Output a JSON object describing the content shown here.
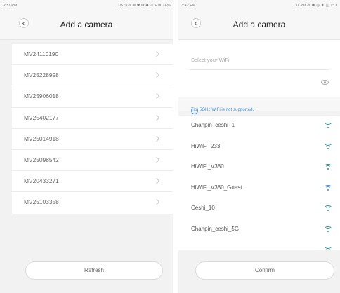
{
  "left_screen": {
    "status": {
      "time": "3:37 PM",
      "icons": "...057K/s ⦾ ✱ ◎ ✦ ◫ + ▭ 14%"
    },
    "title": "Add a camera",
    "cameras": [
      "MV24110190",
      "MV25228998",
      "MV25906018",
      "MV25402177",
      "MV25014918",
      "MV25098542",
      "MV20433271",
      "MV25103358"
    ],
    "button_label": "Refresh"
  },
  "right_screen": {
    "status": {
      "time": "3:42 PM",
      "icons": "...0.39K/s ✱ ◎ ✦ ◫ ▭ 1"
    },
    "title": "Add a camera",
    "wifi_placeholder": "Select your WiFi",
    "tip": "Tip: 5GHz WiFi is not supported.",
    "networks": [
      {
        "name": "Chanpin_ceshi+1",
        "icon": "wifi-icon"
      },
      {
        "name": "HiWiFi_233",
        "icon": "wifi-icon"
      },
      {
        "name": "HiWiFi_V380",
        "icon": "wifi-icon"
      },
      {
        "name": "HiWiFi_V380_Guest",
        "icon": "wifi-icon-blue"
      },
      {
        "name": "Ceshi_10",
        "icon": "wifi-icon"
      },
      {
        "name": "Chanpin_ceshi_5G",
        "icon": "wifi-icon"
      }
    ],
    "button_label": "Confirm"
  },
  "colors": {
    "accent": "#3a8ee6",
    "wifi": "#2c8f8f"
  }
}
